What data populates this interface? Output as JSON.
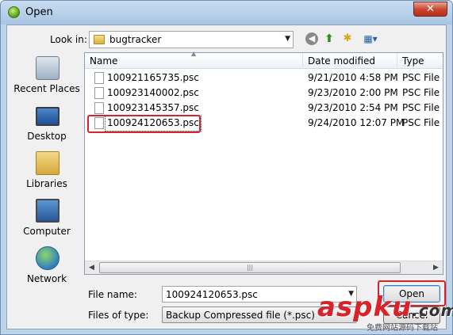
{
  "window": {
    "title": "Open",
    "close_glyph": "✕"
  },
  "lookin": {
    "label": "Look in:",
    "value": "bugtracker"
  },
  "toolbar_icons": [
    "back-icon",
    "up-folder-icon",
    "new-folder-icon",
    "views-menu-icon"
  ],
  "places": [
    {
      "label": "Recent Places",
      "icon": "recent-places-icon"
    },
    {
      "label": "Desktop",
      "icon": "desktop-icon"
    },
    {
      "label": "Libraries",
      "icon": "libraries-icon"
    },
    {
      "label": "Computer",
      "icon": "computer-icon"
    },
    {
      "label": "Network",
      "icon": "network-icon"
    }
  ],
  "columns": {
    "name": "Name",
    "date": "Date modified",
    "type": "Type"
  },
  "files": [
    {
      "name": "100921165735.psc",
      "date": "9/21/2010 4:58 PM",
      "type": "PSC File"
    },
    {
      "name": "100923140002.psc",
      "date": "9/23/2010 2:00 PM",
      "type": "PSC File"
    },
    {
      "name": "100923145357.psc",
      "date": "9/23/2010 2:54 PM",
      "type": "PSC File"
    },
    {
      "name": "100924120653.psc",
      "date": "9/24/2010 12:07 PM",
      "type": "PSC File"
    }
  ],
  "filename": {
    "label": "File name:",
    "value": "100924120653.psc"
  },
  "filetype": {
    "label": "Files of type:",
    "value": "Backup Compressed file (*.psc)"
  },
  "buttons": {
    "open": "Open",
    "cancel": "Cancel"
  },
  "colors": {
    "highlight": "#d8232a",
    "titlebar": "#bcd3ea"
  },
  "watermark": {
    "main": "aspku",
    "tld": ".com",
    "sub": "免费网站源码下载站"
  }
}
